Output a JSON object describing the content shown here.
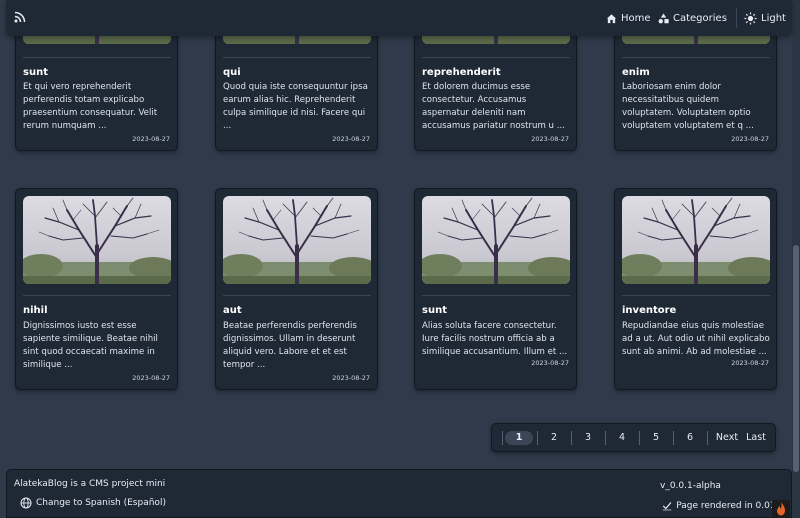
{
  "nav": {
    "home_label": "Home",
    "categories_label": "Categories",
    "theme_label": "Light"
  },
  "cards_row1": [
    {
      "title": "sunt",
      "desc": "Et qui vero reprehenderit\nperferendis totam explicabo\npraesentium consequatur. Velit\nrerum numquam ...",
      "date": "2023-08-27"
    },
    {
      "title": "qui",
      "desc": "Quod quia iste consequuntur ipsa\nearum alias hic. Reprehenderit\nculpa similique id nisi. Facere qui\n...",
      "date": "2023-08-27"
    },
    {
      "title": "reprehenderit",
      "desc": "Et dolorem ducimus esse\nconsectetur. Accusamus\naspernatur deleniti nam\naccusamus pariatur nostrum u ...",
      "date": "2023-08-27"
    },
    {
      "title": "enim",
      "desc": "Laboriosam enim dolor\nnecessitatibus quidem\nvoluptatem. Voluptatem optio\nvoluptatem voluptatem et q ...",
      "date": "2023-08-27"
    }
  ],
  "cards_row2": [
    {
      "title": "nihil",
      "desc": "Dignissimos iusto est esse\nsapiente similique. Beatae nihil\nsint quod occaecati maxime in\nsimilique ...",
      "date": "2023-08-27"
    },
    {
      "title": "aut",
      "desc": "Beatae perferendis perferendis\ndignissimos. Ullam in deserunt\naliquid vero. Labore et et est\ntempor ...",
      "date": "2023-08-27"
    },
    {
      "title": "sunt",
      "desc": "Alias soluta facere consectetur.\nIure facilis nostrum officia ab a\nsimilique accusantium. Illum et ...",
      "date": "2023-08-27"
    },
    {
      "title": "inventore",
      "desc": "Repudiandae eius quis molestiae\nad a ut. Aut odio ut nihil explicabo\nsunt ab animi. Ab ad molestiae ...",
      "date": "2023-08-27"
    }
  ],
  "pagination": {
    "pages": [
      "1",
      "2",
      "3",
      "4",
      "5",
      "6"
    ],
    "active_page": "1",
    "next_label": "Next",
    "last_label": "Last"
  },
  "footer": {
    "about": "AlatekaBlog is a CMS project mini",
    "language_link": "Change to Spanish (Español)",
    "version": "v_0.0.1-alpha",
    "rendered": "Page rendered in 0.0197"
  },
  "colors": {
    "background": "#2f3b4b",
    "surface": "#1f2835",
    "text": "#e8edf3",
    "active_page_bg": "#3a4656"
  },
  "icons": {
    "rss": "rss-icon",
    "home": "home-icon",
    "categories": "shapes-icon",
    "theme": "sun-icon",
    "language": "globe-icon",
    "rendered": "check-icon"
  }
}
